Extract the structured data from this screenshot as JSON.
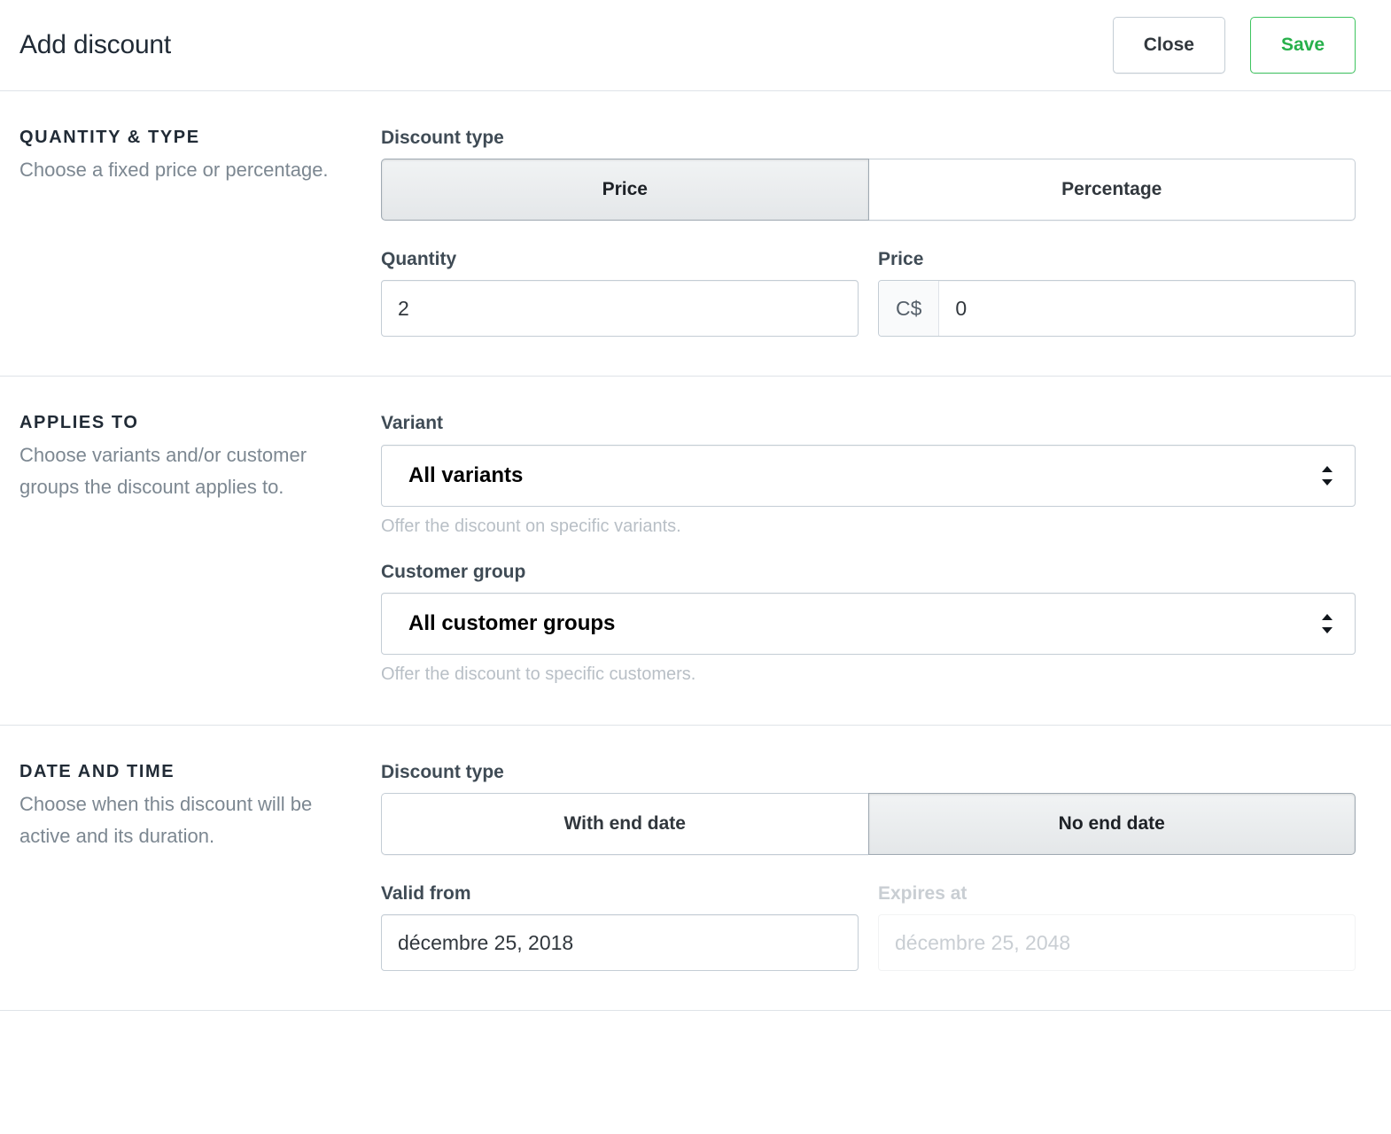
{
  "header": {
    "title": "Add discount",
    "close_label": "Close",
    "save_label": "Save",
    "save_color": "#27b04b"
  },
  "sections": {
    "quantity_type": {
      "heading": "QUANTITY & TYPE",
      "description": "Choose a fixed price or percentage.",
      "discount_type_label": "Discount type",
      "options": [
        {
          "label": "Price",
          "selected": true
        },
        {
          "label": "Percentage",
          "selected": false
        }
      ],
      "quantity_label": "Quantity",
      "quantity_value": "2",
      "price_label": "Price",
      "price_currency": "C$",
      "price_value": "0"
    },
    "applies_to": {
      "heading": "APPLIES TO",
      "description": "Choose variants and/or customer groups the discount applies to.",
      "variant_label": "Variant",
      "variant_value": "All variants",
      "variant_help": "Offer the discount on specific variants.",
      "customer_group_label": "Customer group",
      "customer_group_value": "All customer groups",
      "customer_group_help": "Offer the discount to specific customers."
    },
    "date_and_time": {
      "heading": "DATE AND TIME",
      "description": "Choose when this discount will be active and its duration.",
      "discount_type_label": "Discount type",
      "options": [
        {
          "label": "With end date",
          "selected": false
        },
        {
          "label": "No end date",
          "selected": true
        }
      ],
      "valid_from_label": "Valid from",
      "valid_from_value": "décembre 25, 2018",
      "expires_at_label": "Expires at",
      "expires_at_placeholder": "décembre 25, 2048"
    }
  }
}
